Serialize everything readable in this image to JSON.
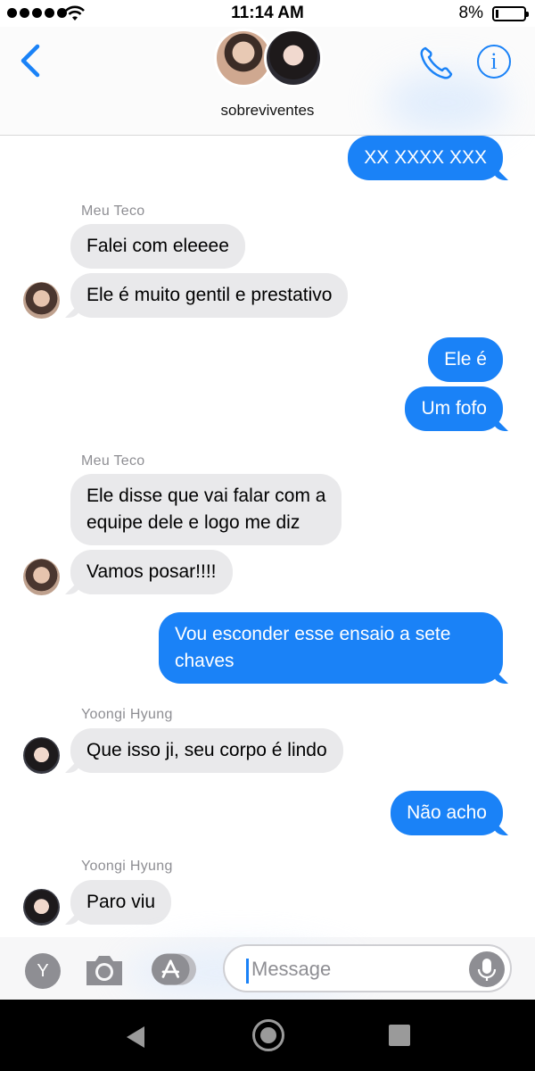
{
  "status_bar": {
    "time": "11:14 AM",
    "battery": "8%"
  },
  "header": {
    "title": "sobreviventes"
  },
  "messages": [
    {
      "type": "out",
      "text": "XX XXXX XXX"
    },
    {
      "type": "sender",
      "text": "Meu Teco"
    },
    {
      "type": "in",
      "text": "Falei com eleeee"
    },
    {
      "type": "in",
      "text": "Ele é muito gentil e prestativo"
    },
    {
      "type": "out",
      "text": "Ele é"
    },
    {
      "type": "out",
      "text": "Um fofo"
    },
    {
      "type": "sender",
      "text": "Meu Teco"
    },
    {
      "type": "in",
      "text": "Ele disse que vai falar com a\nequipe dele e logo me diz"
    },
    {
      "type": "in",
      "text": "Vamos posar!!!!"
    },
    {
      "type": "out",
      "text": "Vou esconder esse ensaio a sete\nchaves"
    },
    {
      "type": "sender",
      "text": "Yoongi Hyung"
    },
    {
      "type": "in",
      "text": "Que isso ji, seu corpo é lindo"
    },
    {
      "type": "out",
      "text": "Não acho"
    },
    {
      "type": "sender",
      "text": "Yoongi Hyung"
    },
    {
      "type": "in",
      "text": "Paro viu"
    }
  ],
  "input_bar": {
    "app_letter": "Y",
    "placeholder": "Message"
  },
  "colors": {
    "accent": "#1a82f7",
    "incoming_bubble": "#e9e9eb",
    "outgoing_bubble": "#1a82f7"
  },
  "icons": [
    "back-chevron-icon",
    "phone-icon",
    "info-icon",
    "camera-icon",
    "app-store-icon",
    "microphone-icon"
  ]
}
